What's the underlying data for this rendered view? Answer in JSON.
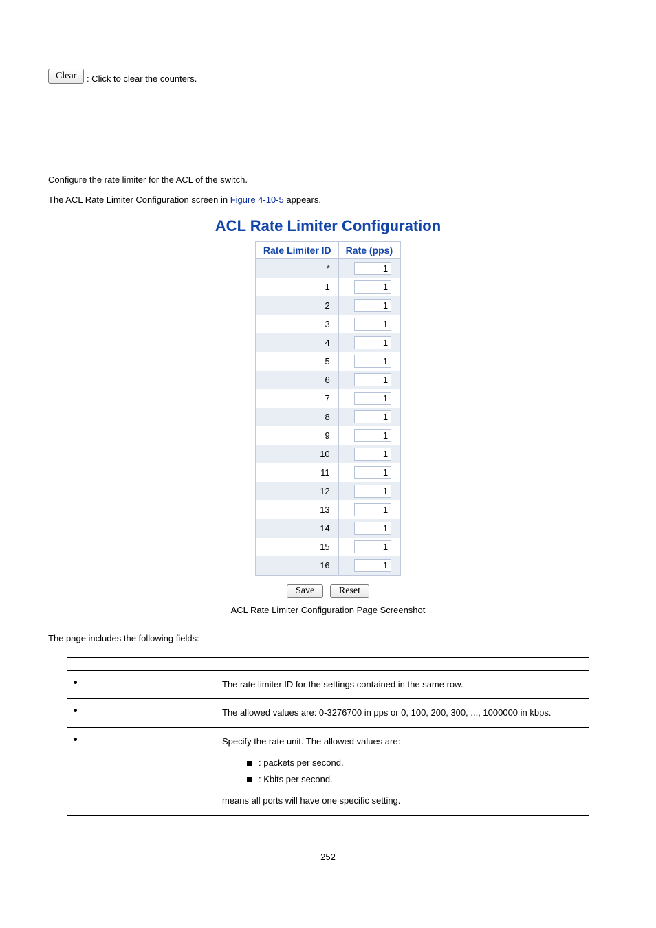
{
  "clear": {
    "button_label": "Clear",
    "description": ": Click to clear the counters."
  },
  "intro": {
    "line1": "Configure the rate limiter for the ACL of the switch.",
    "line2_pre": "The ACL Rate Limiter Configuration screen in ",
    "line2_link": "Figure 4-10-5",
    "line2_post": " appears."
  },
  "config": {
    "title": "ACL Rate Limiter Configuration",
    "head_col1": "Rate Limiter ID",
    "head_col2": "Rate (pps)",
    "rows": [
      {
        "id": "*",
        "rate": "1"
      },
      {
        "id": "1",
        "rate": "1"
      },
      {
        "id": "2",
        "rate": "1"
      },
      {
        "id": "3",
        "rate": "1"
      },
      {
        "id": "4",
        "rate": "1"
      },
      {
        "id": "5",
        "rate": "1"
      },
      {
        "id": "6",
        "rate": "1"
      },
      {
        "id": "7",
        "rate": "1"
      },
      {
        "id": "8",
        "rate": "1"
      },
      {
        "id": "9",
        "rate": "1"
      },
      {
        "id": "10",
        "rate": "1"
      },
      {
        "id": "11",
        "rate": "1"
      },
      {
        "id": "12",
        "rate": "1"
      },
      {
        "id": "13",
        "rate": "1"
      },
      {
        "id": "14",
        "rate": "1"
      },
      {
        "id": "15",
        "rate": "1"
      },
      {
        "id": "16",
        "rate": "1"
      }
    ],
    "save_label": "Save",
    "reset_label": "Reset"
  },
  "caption": "ACL Rate Limiter Configuration Page Screenshot",
  "fields_intro": "The page includes the following fields:",
  "field_table": {
    "rows": [
      {
        "object": "",
        "desc": ""
      },
      {
        "object": "",
        "desc": "The rate limiter ID for the settings contained in the same row."
      },
      {
        "object": "",
        "desc": "The allowed values are: 0-3276700 in pps or 0, 100, 200, 300, ..., 1000000 in kbps."
      }
    ],
    "unit_row": {
      "object": "",
      "desc_intro": "Specify the rate unit. The allowed values are:",
      "unit1_desc": ": packets per second.",
      "unit2_desc": ": Kbits per second.",
      "desc_outro": "means all ports will have one specific setting."
    }
  },
  "page_number": "252"
}
